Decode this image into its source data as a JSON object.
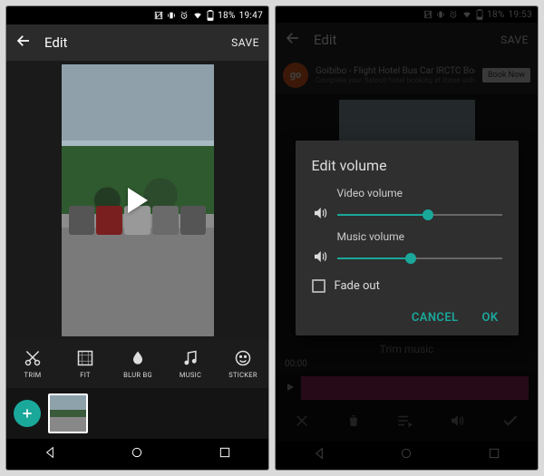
{
  "left": {
    "status": {
      "battery": "18%",
      "time": "19:47"
    },
    "appbar": {
      "title": "Edit",
      "save": "SAVE"
    },
    "tools": [
      {
        "name": "trim",
        "label": "TRIM"
      },
      {
        "name": "fit",
        "label": "FIT"
      },
      {
        "name": "blurbg",
        "label": "BLUR BG"
      },
      {
        "name": "music",
        "label": "MUSIC"
      },
      {
        "name": "sticker",
        "label": "STICKER"
      }
    ]
  },
  "right": {
    "status": {
      "battery": "18%",
      "time": "19:53"
    },
    "appbar": {
      "title": "Edit",
      "save": "SAVE"
    },
    "ad": {
      "brand": "go",
      "title": "Goibibo - Flight Hotel Bus Car IRCTC Boo...",
      "sub": "Complete your flatooti hotel booking at these unbelievable...",
      "cta": "Book Now"
    },
    "trim_label": "Trim music",
    "time_start": "00:00",
    "dialog": {
      "title": "Edit volume",
      "video_label": "Video volume",
      "video_pct": 55,
      "music_label": "Music volume",
      "music_pct": 45,
      "fade_label": "Fade out",
      "cancel": "CANCEL",
      "ok": "OK"
    }
  },
  "colors": {
    "accent": "#1aa89b",
    "track": "#a12a5e"
  }
}
